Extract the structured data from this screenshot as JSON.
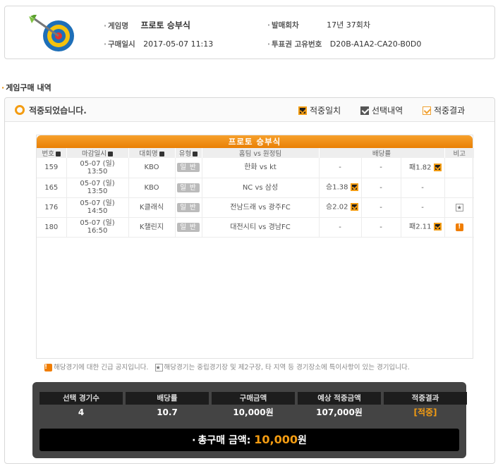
{
  "info": {
    "game_name_label": "게임명",
    "game_name": "프로토 승부식",
    "purchase_date_label": "구매일시",
    "purchase_date": "2017-05-07 11:13",
    "issue_round_label": "발매회차",
    "issue_round": "17년 37회차",
    "ticket_id_label": "투표권 고유번호",
    "ticket_id": "D20B-A1A2-CA20-B0D0"
  },
  "section_title": "게임구매 내역",
  "result": {
    "status": "적중되었습니다.",
    "legend": {
      "match": "적중일치",
      "selection": "선택내역",
      "result": "적중결과"
    }
  },
  "table": {
    "title": "프로토 승부식",
    "headers": {
      "no": "번호",
      "deadline": "마감일시",
      "league": "대회명",
      "type": "유형",
      "teams": "홈팀 vs 원정팀",
      "odds": "배당률",
      "note": "비고"
    },
    "rows": [
      {
        "no": "159",
        "date": "05-07 (일)",
        "time": "13:50",
        "league": "KBO",
        "type": "일 반",
        "teams": "한화 vs kt",
        "odd1": "-",
        "odd2": "-",
        "odd3": "패1.82",
        "note": ""
      },
      {
        "no": "165",
        "date": "05-07 (일)",
        "time": "13:50",
        "league": "KBO",
        "type": "일 반",
        "teams": "NC vs 삼성",
        "odd1": "승1.38",
        "odd2": "-",
        "odd3": "-",
        "note": ""
      },
      {
        "no": "176",
        "date": "05-07 (일)",
        "time": "14:50",
        "league": "K클래식",
        "type": "일 반",
        "teams": "전남드래 vs 광주FC",
        "odd1": "승2.02",
        "odd2": "-",
        "odd3": "-",
        "note": "★"
      },
      {
        "no": "180",
        "date": "05-07 (일)",
        "time": "16:50",
        "league": "K챌린지",
        "type": "일 반",
        "teams": "대전시티 vs 경남FC",
        "odd1": "-",
        "odd2": "-",
        "odd3": "패2.11",
        "note": "!"
      }
    ]
  },
  "notice": {
    "urgent": "해당경기에 대한 긴급 공지입니다.",
    "special": "해당경기는 중립경기장 및 제2구장, 타 지역 등 경기장소에 특이사항이 있는 경기입니다."
  },
  "summary": {
    "count_label": "선택 경기수",
    "count": "4",
    "odds_label": "배당률",
    "odds": "10.7",
    "amount_label": "구매금액",
    "amount": "10,000원",
    "expected_label": "예상 적중금액",
    "expected": "107,000원",
    "result_label": "적중결과",
    "result": "[적중]",
    "total_label": "총구매 금액:",
    "total_amount": "10,000",
    "total_unit": "원"
  },
  "colors": {
    "accent": "#f39c12",
    "title_bar": "#ee8a10",
    "summary_bg": "#444444"
  }
}
